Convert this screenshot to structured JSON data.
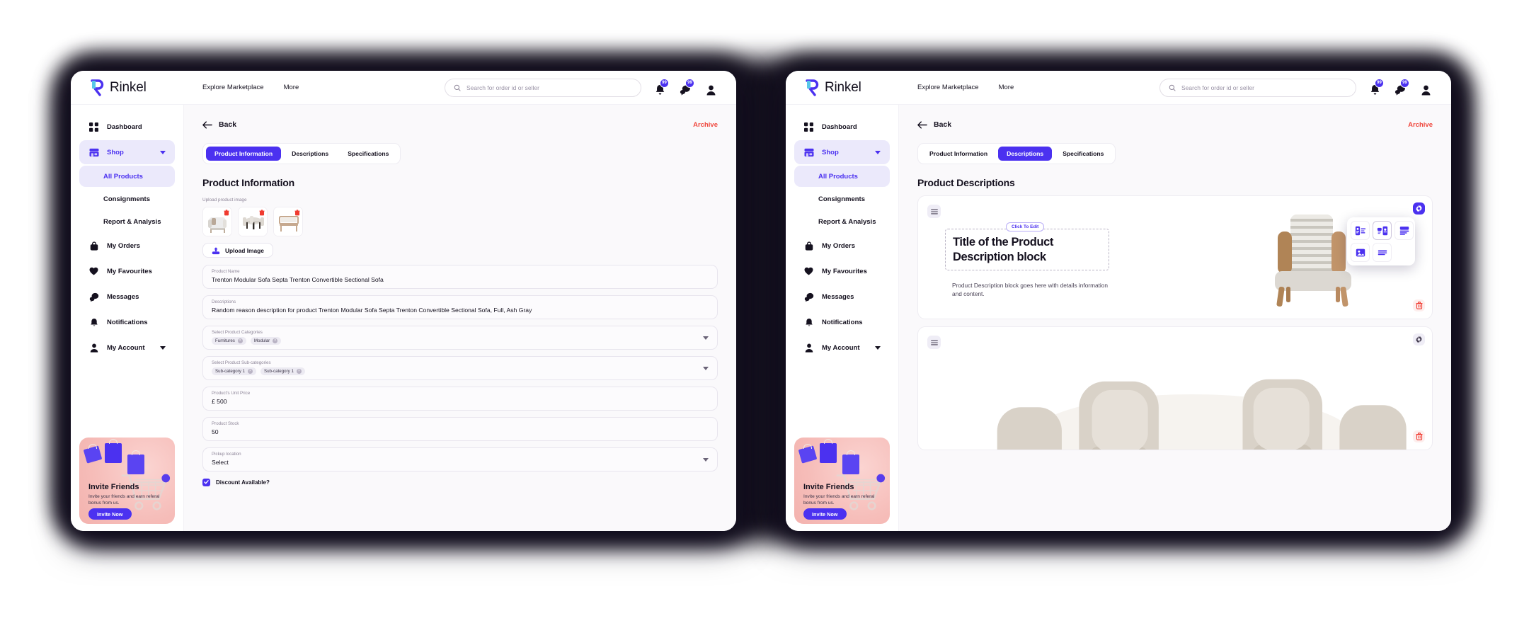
{
  "brand": {
    "name": "Rinkel"
  },
  "topnav": {
    "links": [
      "Explore Marketplace",
      "More"
    ]
  },
  "search": {
    "placeholder": "Search for order id or seller"
  },
  "notifications": {
    "bell_badge": "99",
    "message_badge": "99"
  },
  "sidebar": {
    "items": [
      {
        "label": "Dashboard",
        "icon": "grid-icon",
        "active": false
      },
      {
        "label": "Shop",
        "icon": "store-icon",
        "active": true,
        "expandable": true
      },
      {
        "label": "All Products",
        "icon": "none",
        "active": true,
        "sub": true
      },
      {
        "label": "Consignments",
        "icon": "none",
        "active": false,
        "sub": true
      },
      {
        "label": "Report & Analysis",
        "icon": "none",
        "active": false,
        "sub": true
      },
      {
        "label": "My Orders",
        "icon": "bag-icon",
        "active": false
      },
      {
        "label": "My Favourites",
        "icon": "heart-icon",
        "active": false
      },
      {
        "label": "Messages",
        "icon": "chat-icon",
        "active": false
      },
      {
        "label": "Notifications",
        "icon": "bell-icon",
        "active": false
      },
      {
        "label": "My Account",
        "icon": "user-icon",
        "active": false,
        "expandable": true
      }
    ],
    "invite": {
      "title": "Invite Friends",
      "subtitle": "Invite your friends and earn referal bonus from us.",
      "button": "Invite Now"
    }
  },
  "left_window": {
    "back": "Back",
    "archive": "Archive",
    "tabs": [
      {
        "label": "Product Information",
        "active": true
      },
      {
        "label": "Descriptions",
        "active": false
      },
      {
        "label": "Specifications",
        "active": false
      }
    ],
    "heading": "Product Information",
    "upload_label": "Upload product image",
    "upload_button": "Upload Image",
    "thumb_count": 3,
    "fields": [
      {
        "label": "Product Name",
        "value": "Trenton Modular Sofa Septa Trenton Convertible Sectional Sofa",
        "type": "text"
      },
      {
        "label": "Descriptions",
        "value": "Random reason description for product Trenton Modular Sofa Septa Trenton Convertible Sectional Sofa, Full, Ash Gray",
        "type": "text"
      },
      {
        "label": "Select Product Categories",
        "value": "",
        "type": "chips",
        "chips": [
          "Furnitures",
          "Modular"
        ]
      },
      {
        "label": "Select Product Sub-categories",
        "value": "",
        "type": "chips",
        "chips": [
          "Sub-category 1",
          "Sub-category 1"
        ]
      },
      {
        "label": "Product's Unit Price",
        "value": "£ 500",
        "type": "text"
      },
      {
        "label": "Product Stock",
        "value": "50",
        "type": "text"
      },
      {
        "label": "Pickup location",
        "value": "Select",
        "type": "select"
      }
    ],
    "discount_checkbox": {
      "label": "Discount Available?",
      "checked": true
    }
  },
  "right_window": {
    "back": "Back",
    "archive": "Archive",
    "tabs": [
      {
        "label": "Product Information",
        "active": false
      },
      {
        "label": "Descriptions",
        "active": true
      },
      {
        "label": "Specifications",
        "active": false
      }
    ],
    "heading": "Product Descriptions",
    "block1": {
      "edit_tooltip": "Click To Edit",
      "title": "Title of the Product Description block",
      "body": "Product Description block goes here with details information and content.",
      "layout_options": [
        "layout-text-left",
        "layout-split",
        "layout-stacked",
        "layout-image",
        "layout-full-text"
      ],
      "selected_layout_index": 1
    },
    "block2": {
      "image": "dining-set-photo"
    }
  },
  "colors": {
    "accent": "#4b31f0",
    "accent_soft": "#ebe9fb",
    "danger": "#f0483e",
    "ink": "#15111f",
    "muted": "#8d8598",
    "page_bg": "#faf9fb",
    "invite_bg": "#f6bdb9"
  }
}
